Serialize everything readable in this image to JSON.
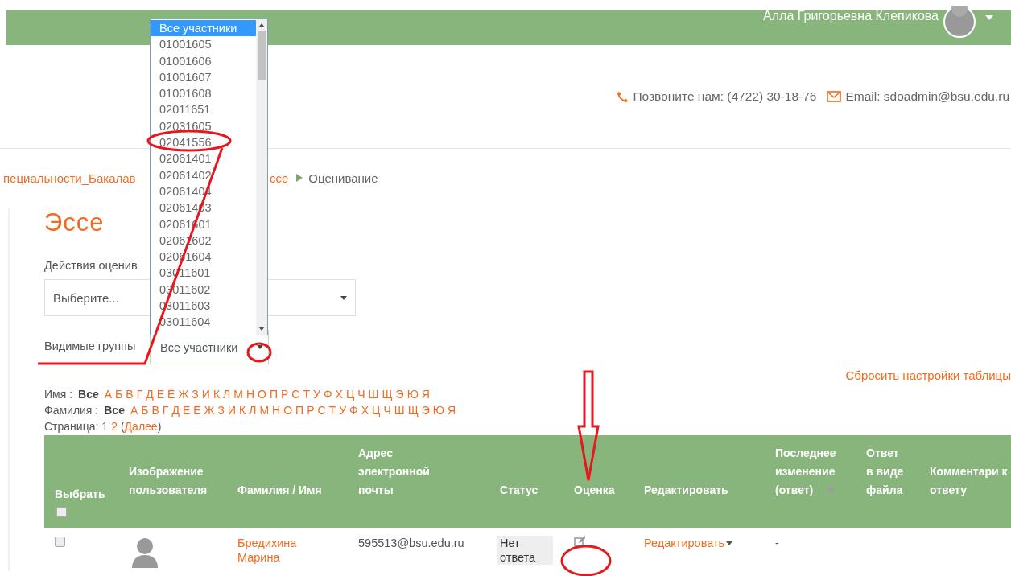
{
  "header": {
    "user_name": "Алла Григорьевна Клепикова",
    "phone": "Позвоните нам: (4722) 30-18-76",
    "email": "Email: sdoadmin@bsu.edu.ru"
  },
  "breadcrumb": [
    {
      "label": "пециальности_Бакалав",
      "current": false
    },
    {
      "label": "ссе",
      "current": false
    },
    {
      "label": "Оценивание",
      "current": true
    }
  ],
  "page_title": "Эссе",
  "grading_actions": {
    "label": "Действия оценив",
    "value": "Выберите..."
  },
  "visible_groups": {
    "label": "Видимые группы",
    "value": "Все участники",
    "expanded": true,
    "options": [
      {
        "label": "Все участники",
        "selected": true
      },
      {
        "label": "01001605",
        "selected": false
      },
      {
        "label": "01001606",
        "selected": false
      },
      {
        "label": "01001607",
        "selected": false
      },
      {
        "label": "01001608",
        "selected": false
      },
      {
        "label": "02011651",
        "selected": false
      },
      {
        "label": "02031605",
        "selected": false
      },
      {
        "label": "02041556",
        "selected": false
      },
      {
        "label": "02061401",
        "selected": false
      },
      {
        "label": "02061402",
        "selected": false
      },
      {
        "label": "02061404",
        "selected": false
      },
      {
        "label": "02061403",
        "selected": false
      },
      {
        "label": "02061601",
        "selected": false
      },
      {
        "label": "02061602",
        "selected": false
      },
      {
        "label": "02061604",
        "selected": false
      },
      {
        "label": "03011601",
        "selected": false
      },
      {
        "label": "03011602",
        "selected": false
      },
      {
        "label": "03011603",
        "selected": false
      },
      {
        "label": "03011604",
        "selected": false
      }
    ]
  },
  "reset_link": "Сбросить настройки таблицы",
  "filters": [
    {
      "label": "Имя :",
      "all": "Все",
      "letters": [
        "А",
        "Б",
        "В",
        "Г",
        "Д",
        "Е",
        "Ё",
        "Ж",
        "З",
        "И",
        "К",
        "Л",
        "М",
        "Н",
        "О",
        "П",
        "Р",
        "С",
        "Т",
        "У",
        "Ф",
        "Х",
        "Ц",
        "Ч",
        "Ш",
        "Щ",
        "Э",
        "Ю",
        "Я"
      ]
    },
    {
      "label": "Фамилия :",
      "all": "Все",
      "letters": [
        "А",
        "Б",
        "В",
        "Г",
        "Д",
        "Е",
        "Ё",
        "Ж",
        "З",
        "И",
        "К",
        "Л",
        "М",
        "Н",
        "О",
        "П",
        "Р",
        "С",
        "Т",
        "У",
        "Ф",
        "Х",
        "Ц",
        "Ч",
        "Ш",
        "Щ",
        "Э",
        "Ю",
        "Я"
      ]
    }
  ],
  "paging": {
    "label": "Страница:",
    "pages": [
      {
        "label": "1",
        "selected": true
      },
      {
        "label": "2",
        "selected": false
      }
    ],
    "open": "(",
    "next": "Далее",
    "close": ")"
  },
  "table": {
    "select_all_checked": false,
    "columns": [
      {
        "kind": "select",
        "label": "Выбрать"
      },
      {
        "kind": "text",
        "label": "Изображение пользователя"
      },
      {
        "kind": "text",
        "label": "Фамилия / Имя"
      },
      {
        "kind": "text",
        "label": "Адрес электронной почты"
      },
      {
        "kind": "text",
        "label": "Статус"
      },
      {
        "kind": "text",
        "label": "Оценка"
      },
      {
        "kind": "text",
        "label": "Редактировать"
      },
      {
        "kind": "sorted",
        "label": "Последнее изменение (ответ)"
      },
      {
        "kind": "text",
        "label": "Ответ в виде файла"
      },
      {
        "kind": "text",
        "label": "Комментари к ответу"
      }
    ],
    "rows": [
      {
        "checked": false,
        "name": "Бредихина Марина",
        "email": "595513@bsu.edu.ru",
        "status": "Нет ответа",
        "edit": "Редактировать",
        "last_modified": "-"
      }
    ]
  }
}
